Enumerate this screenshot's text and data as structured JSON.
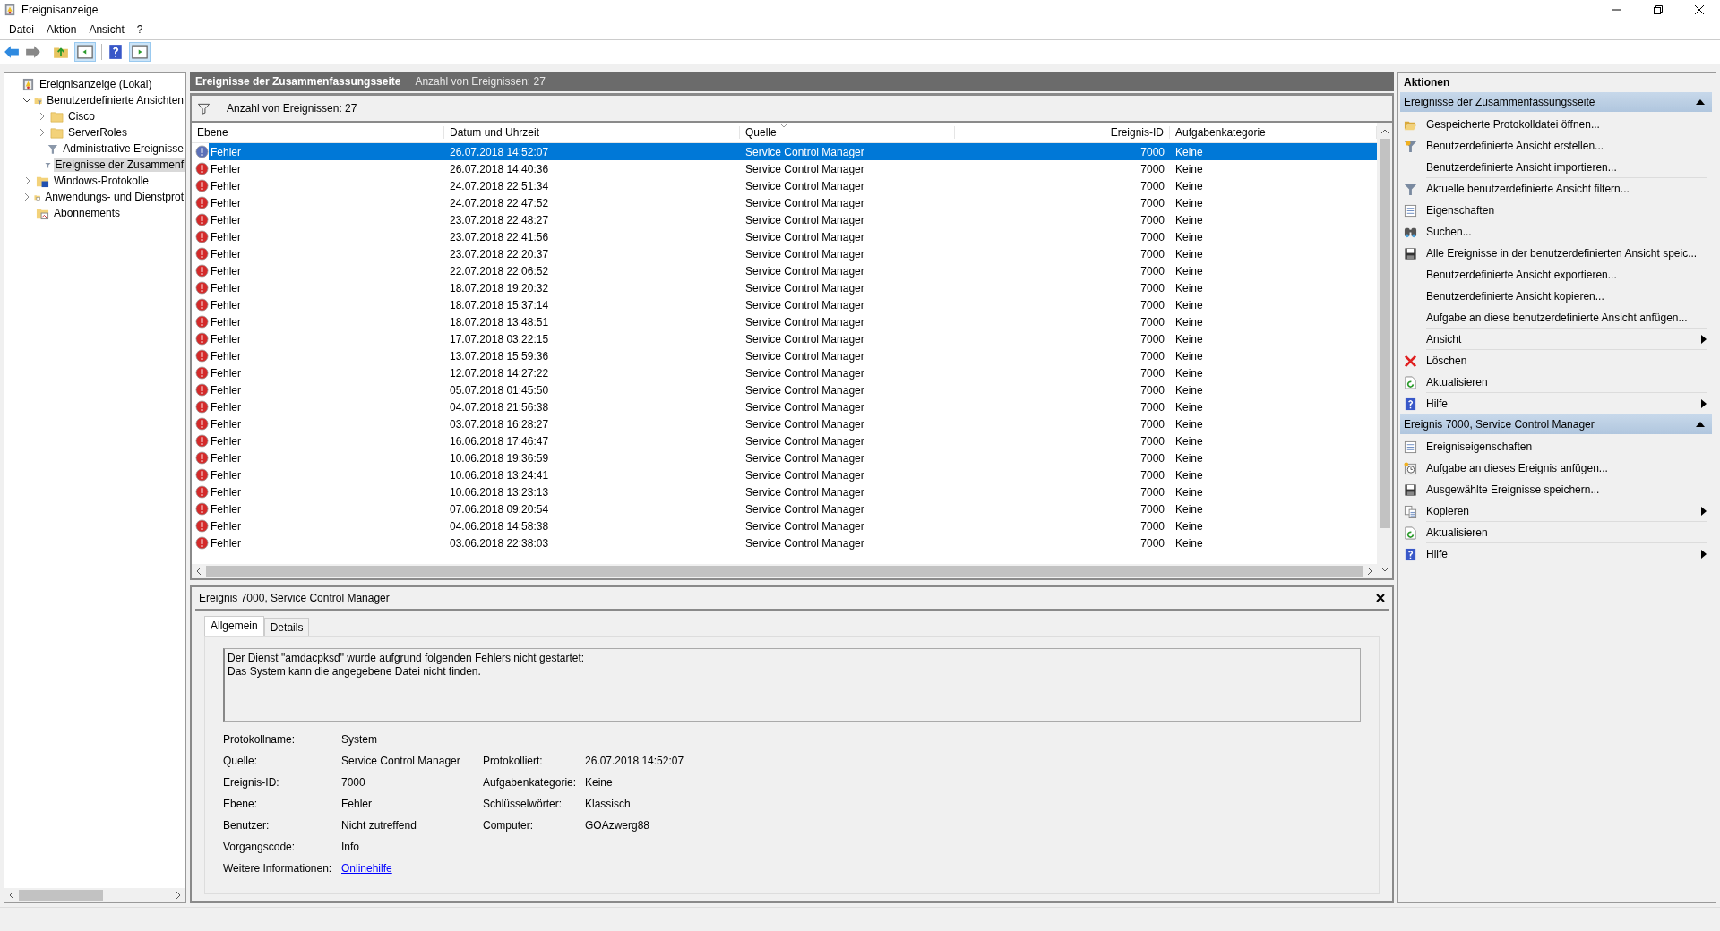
{
  "window": {
    "title": "Ereignisanzeige"
  },
  "menu": [
    {
      "label": "Datei"
    },
    {
      "label": "Aktion"
    },
    {
      "label": "Ansicht"
    },
    {
      "label": "?"
    }
  ],
  "tree": [
    {
      "label": "Ereignisanzeige (Lokal)",
      "kind": "viewer",
      "selected": false,
      "children": [
        {
          "label": "Benutzerdefinierte Ansichten",
          "kind": "folder-filter",
          "expanded": true,
          "selected": false,
          "children": [
            {
              "label": "Cisco",
              "kind": "folder",
              "expanded": false,
              "selected": false
            },
            {
              "label": "ServerRoles",
              "kind": "folder",
              "expanded": false,
              "selected": false
            },
            {
              "label": "Administrative Ereignisse",
              "kind": "filter",
              "selected": false
            },
            {
              "label": "Ereignisse der Zusammenf",
              "kind": "filter",
              "selected": true
            }
          ]
        },
        {
          "label": "Windows-Protokolle",
          "kind": "logs",
          "expanded": false,
          "selected": false
        },
        {
          "label": "Anwendungs- und Dienstprot",
          "kind": "apps",
          "expanded": false,
          "selected": false
        },
        {
          "label": "Abonnements",
          "kind": "subscriptions",
          "selected": false
        }
      ]
    }
  ],
  "summary": {
    "title": "Ereignisse der Zusammenfassungsseite",
    "count": "Anzahl von Ereignissen: 27"
  },
  "filter_bar": {
    "text": "Anzahl von Ereignissen: 27"
  },
  "table": {
    "columns": [
      "Ebene",
      "Datum und Uhrzeit",
      "Quelle",
      "Ereignis-ID",
      "Aufgabenkategorie"
    ],
    "rows": [
      {
        "level": "Fehler",
        "datetime": "26.07.2018 14:52:07",
        "source": "Service Control Manager",
        "event_id": "7000",
        "category": "Keine",
        "selected": true
      },
      {
        "level": "Fehler",
        "datetime": "26.07.2018 14:40:36",
        "source": "Service Control Manager",
        "event_id": "7000",
        "category": "Keine",
        "selected": false
      },
      {
        "level": "Fehler",
        "datetime": "24.07.2018 22:51:34",
        "source": "Service Control Manager",
        "event_id": "7000",
        "category": "Keine",
        "selected": false
      },
      {
        "level": "Fehler",
        "datetime": "24.07.2018 22:47:52",
        "source": "Service Control Manager",
        "event_id": "7000",
        "category": "Keine",
        "selected": false
      },
      {
        "level": "Fehler",
        "datetime": "23.07.2018 22:48:27",
        "source": "Service Control Manager",
        "event_id": "7000",
        "category": "Keine",
        "selected": false
      },
      {
        "level": "Fehler",
        "datetime": "23.07.2018 22:41:56",
        "source": "Service Control Manager",
        "event_id": "7000",
        "category": "Keine",
        "selected": false
      },
      {
        "level": "Fehler",
        "datetime": "23.07.2018 22:20:37",
        "source": "Service Control Manager",
        "event_id": "7000",
        "category": "Keine",
        "selected": false
      },
      {
        "level": "Fehler",
        "datetime": "22.07.2018 22:06:52",
        "source": "Service Control Manager",
        "event_id": "7000",
        "category": "Keine",
        "selected": false
      },
      {
        "level": "Fehler",
        "datetime": "18.07.2018 19:20:32",
        "source": "Service Control Manager",
        "event_id": "7000",
        "category": "Keine",
        "selected": false
      },
      {
        "level": "Fehler",
        "datetime": "18.07.2018 15:37:14",
        "source": "Service Control Manager",
        "event_id": "7000",
        "category": "Keine",
        "selected": false
      },
      {
        "level": "Fehler",
        "datetime": "18.07.2018 13:48:51",
        "source": "Service Control Manager",
        "event_id": "7000",
        "category": "Keine",
        "selected": false
      },
      {
        "level": "Fehler",
        "datetime": "17.07.2018 03:22:15",
        "source": "Service Control Manager",
        "event_id": "7000",
        "category": "Keine",
        "selected": false
      },
      {
        "level": "Fehler",
        "datetime": "13.07.2018 15:59:36",
        "source": "Service Control Manager",
        "event_id": "7000",
        "category": "Keine",
        "selected": false
      },
      {
        "level": "Fehler",
        "datetime": "12.07.2018 14:27:22",
        "source": "Service Control Manager",
        "event_id": "7000",
        "category": "Keine",
        "selected": false
      },
      {
        "level": "Fehler",
        "datetime": "05.07.2018 01:45:50",
        "source": "Service Control Manager",
        "event_id": "7000",
        "category": "Keine",
        "selected": false
      },
      {
        "level": "Fehler",
        "datetime": "04.07.2018 21:56:38",
        "source": "Service Control Manager",
        "event_id": "7000",
        "category": "Keine",
        "selected": false
      },
      {
        "level": "Fehler",
        "datetime": "03.07.2018 16:28:27",
        "source": "Service Control Manager",
        "event_id": "7000",
        "category": "Keine",
        "selected": false
      },
      {
        "level": "Fehler",
        "datetime": "16.06.2018 17:46:47",
        "source": "Service Control Manager",
        "event_id": "7000",
        "category": "Keine",
        "selected": false
      },
      {
        "level": "Fehler",
        "datetime": "10.06.2018 19:36:59",
        "source": "Service Control Manager",
        "event_id": "7000",
        "category": "Keine",
        "selected": false
      },
      {
        "level": "Fehler",
        "datetime": "10.06.2018 13:24:41",
        "source": "Service Control Manager",
        "event_id": "7000",
        "category": "Keine",
        "selected": false
      },
      {
        "level": "Fehler",
        "datetime": "10.06.2018 13:23:13",
        "source": "Service Control Manager",
        "event_id": "7000",
        "category": "Keine",
        "selected": false
      },
      {
        "level": "Fehler",
        "datetime": "07.06.2018 09:20:54",
        "source": "Service Control Manager",
        "event_id": "7000",
        "category": "Keine",
        "selected": false
      },
      {
        "level": "Fehler",
        "datetime": "04.06.2018 14:58:38",
        "source": "Service Control Manager",
        "event_id": "7000",
        "category": "Keine",
        "selected": false
      },
      {
        "level": "Fehler",
        "datetime": "03.06.2018 22:38:03",
        "source": "Service Control Manager",
        "event_id": "7000",
        "category": "Keine",
        "selected": false
      }
    ]
  },
  "details": {
    "title": "Ereignis 7000, Service Control Manager",
    "tabs": [
      {
        "label": "Allgemein",
        "selected": true
      },
      {
        "label": "Details",
        "selected": false
      }
    ],
    "message": [
      "Der Dienst \"amdacpksd\" wurde aufgrund folgenden Fehlers nicht gestartet:",
      "Das System kann die angegebene Datei nicht finden."
    ],
    "fields": [
      {
        "left": {
          "label": "Protokollname:",
          "value": "System"
        }
      },
      {
        "left": {
          "label": "Quelle:",
          "value": "Service Control Manager"
        },
        "right": {
          "label": "Protokolliert:",
          "value": "26.07.2018 14:52:07"
        }
      },
      {
        "left": {
          "label": "Ereignis-ID:",
          "value": "7000"
        },
        "right": {
          "label": "Aufgabenkategorie:",
          "value": "Keine"
        }
      },
      {
        "left": {
          "label": "Ebene:",
          "value": "Fehler"
        },
        "right": {
          "label": "Schlüsselwörter:",
          "value": "Klassisch"
        }
      },
      {
        "left": {
          "label": "Benutzer:",
          "value": "Nicht zutreffend"
        },
        "right": {
          "label": "Computer:",
          "value": "GOAzwerg88"
        }
      },
      {
        "left": {
          "label": "Vorgangscode:",
          "value": "Info"
        }
      }
    ],
    "more_info": {
      "label": "Weitere Informationen:",
      "link": "Onlinehilfe"
    }
  },
  "actions": {
    "title": "Aktionen",
    "sections": [
      {
        "title": "Ereignisse der Zusammenfassungsseite",
        "expanded": true,
        "items": [
          {
            "label": "Gespeicherte Protokolldatei öffnen...",
            "kind": "open-folder",
            "submenu": false,
            "divider": false
          },
          {
            "label": "Benutzerdefinierte Ansicht erstellen...",
            "kind": "filter-create",
            "submenu": false,
            "divider": false
          },
          {
            "label": "Benutzerdefinierte Ansicht importieren...",
            "kind": "plain",
            "submenu": false,
            "divider": true
          },
          {
            "label": "Aktuelle benutzerdefinierte Ansicht filtern...",
            "kind": "filter",
            "submenu": false,
            "divider": false
          },
          {
            "label": "Eigenschaften",
            "kind": "properties",
            "submenu": false,
            "divider": false
          },
          {
            "label": "Suchen...",
            "kind": "find",
            "submenu": false,
            "divider": false
          },
          {
            "label": "Alle Ereignisse in der benutzerdefinierten Ansicht speic...",
            "kind": "save",
            "submenu": false,
            "divider": false
          },
          {
            "label": "Benutzerdefinierte Ansicht exportieren...",
            "kind": "plain",
            "submenu": false,
            "divider": false
          },
          {
            "label": "Benutzerdefinierte Ansicht kopieren...",
            "kind": "plain",
            "submenu": false,
            "divider": false
          },
          {
            "label": "Aufgabe an diese benutzerdefinierte Ansicht anfügen...",
            "kind": "plain",
            "submenu": false,
            "divider": true
          },
          {
            "label": "Ansicht",
            "kind": "plain",
            "submenu": true,
            "divider": true
          },
          {
            "label": "Löschen",
            "kind": "delete",
            "submenu": false,
            "divider": false
          },
          {
            "label": "Aktualisieren",
            "kind": "refresh",
            "submenu": false,
            "divider": true
          },
          {
            "label": "Hilfe",
            "kind": "help",
            "submenu": true,
            "divider": false
          }
        ]
      },
      {
        "title": "Ereignis 7000, Service Control Manager",
        "expanded": true,
        "items": [
          {
            "label": "Ereigniseigenschaften",
            "kind": "properties",
            "submenu": false,
            "divider": false
          },
          {
            "label": "Aufgabe an dieses Ereignis anfügen...",
            "kind": "task",
            "submenu": false,
            "divider": false
          },
          {
            "label": "Ausgewählte Ereignisse speichern...",
            "kind": "save",
            "submenu": false,
            "divider": false
          },
          {
            "label": "Kopieren",
            "kind": "copy",
            "submenu": true,
            "divider": true
          },
          {
            "label": "Aktualisieren",
            "kind": "refresh",
            "submenu": false,
            "divider": true
          },
          {
            "label": "Hilfe",
            "kind": "help",
            "submenu": true,
            "divider": false
          }
        ]
      }
    ]
  }
}
